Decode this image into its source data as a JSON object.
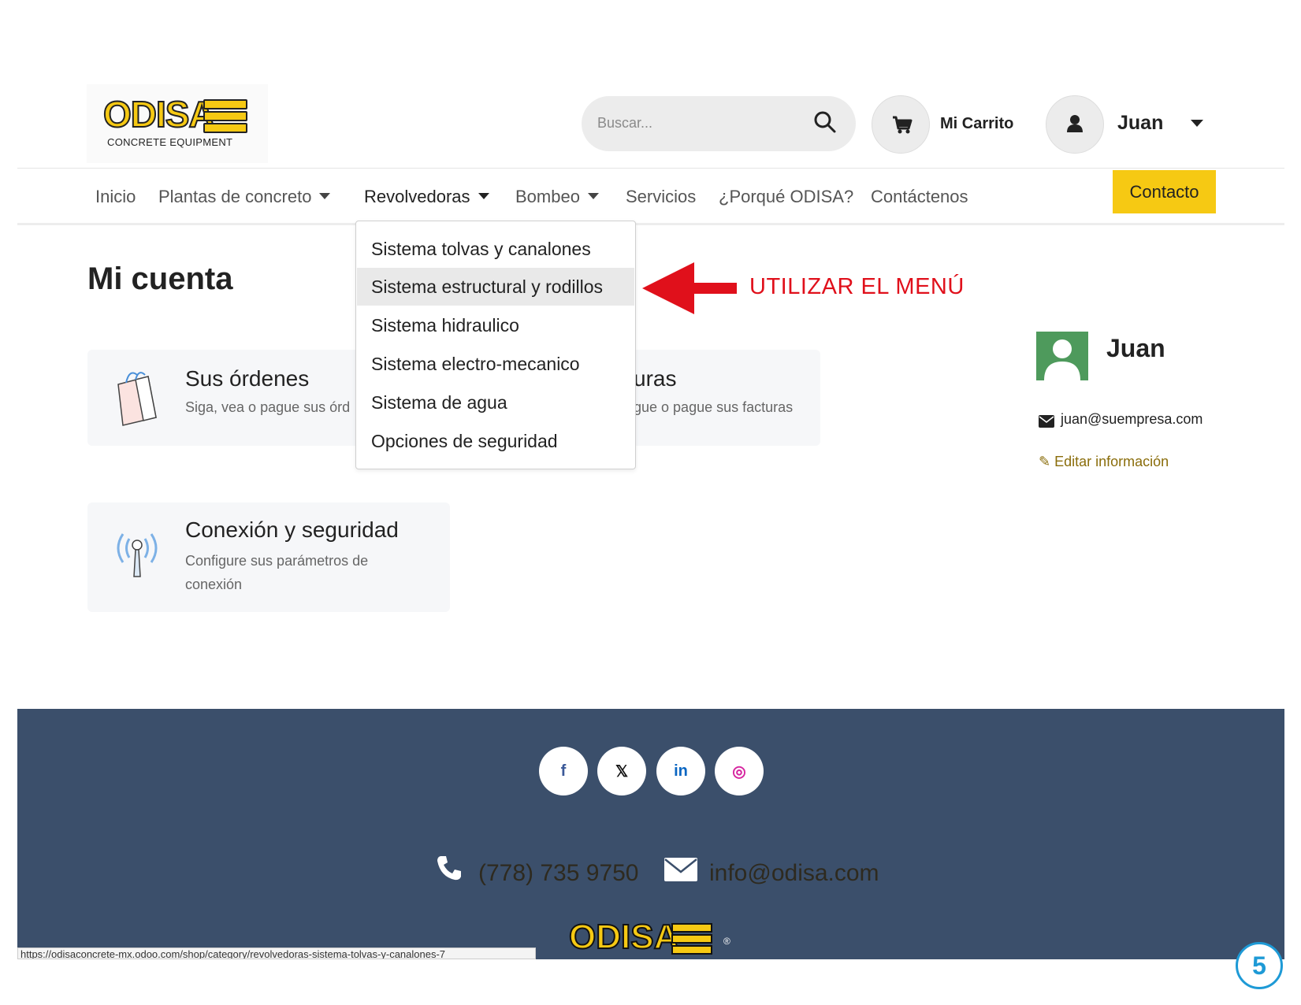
{
  "header": {
    "logo_text": "ODISA",
    "logo_subtitle": "CONCRETE EQUIPMENT",
    "search_placeholder": "Buscar...",
    "cart_label": "Mi Carrito",
    "user_name": "Juan"
  },
  "nav": {
    "items": [
      "Inicio",
      "Plantas de concreto",
      "Revolvedoras",
      "Bombeo",
      "Servicios",
      "¿Porqué ODISA?",
      "Contáctenos"
    ],
    "contact_button": "Contacto"
  },
  "dropdown": {
    "items": [
      "Sistema tolvas y canalones",
      "Sistema estructural y rodillos",
      "Sistema hidraulico",
      "Sistema electro-mecanico",
      "Sistema de agua",
      "Opciones de seguridad"
    ],
    "highlighted_index": 1
  },
  "annotation": "UTILIZAR EL MENÚ",
  "page": {
    "title": "Mi cuenta",
    "cards": [
      {
        "title": "Sus órdenes",
        "subtitle": "Siga, vea o pague sus órd"
      },
      {
        "title": "uras",
        "subtitle": "gue o pague sus facturas"
      },
      {
        "title": "Conexión y seguridad",
        "subtitle_line1": "Configure sus parámetros de",
        "subtitle_line2": "conexión"
      }
    ]
  },
  "profile": {
    "name": "Juan",
    "email": "juan@suempresa.com",
    "edit_label": "Editar información"
  },
  "footer": {
    "social": [
      {
        "name": "facebook-icon",
        "glyph": "f"
      },
      {
        "name": "x-icon",
        "glyph": "𝕏"
      },
      {
        "name": "linkedin-icon",
        "glyph": "in"
      },
      {
        "name": "instagram-icon",
        "glyph": "◎"
      }
    ],
    "phone": "(778) 735 9750",
    "email": "info@odisa.com",
    "logo_text": "ODISA",
    "registered": "®"
  },
  "status_url": "https://odisaconcrete-mx.odoo.com/shop/category/revolvedoras-sistema-tolvas-y-canalones-7",
  "page_number": "5",
  "colors": {
    "brand_yellow": "#f6c913",
    "footer_bg": "#3b4f6b",
    "annotation_red": "#e0101b",
    "page_number_blue": "#1e9ad6"
  }
}
